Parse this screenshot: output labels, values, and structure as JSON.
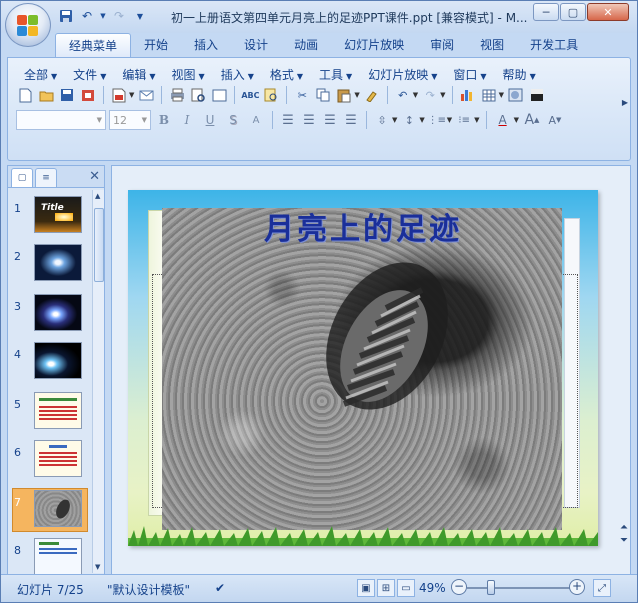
{
  "window": {
    "title": "初一上册语文第四单元月亮上的足迹PPT课件.ppt [兼容模式] - M...",
    "minimize": "─",
    "restore": "▢",
    "close": "✕"
  },
  "qat": {
    "save_icon": "save-icon",
    "undo_icon": "undo-icon",
    "redo_icon": "redo-icon",
    "customize_icon": "dropdown-icon"
  },
  "tabs": [
    "经典菜单",
    "开始",
    "插入",
    "设计",
    "动画",
    "幻灯片放映",
    "审阅",
    "视图",
    "开发工具"
  ],
  "menus": [
    "全部",
    "文件",
    "编辑",
    "视图",
    "插入",
    "格式",
    "工具",
    "幻灯片放映",
    "窗口",
    "帮助"
  ],
  "format": {
    "font_name": "",
    "font_size": "12",
    "bold": "B",
    "italic": "I",
    "underline": "U",
    "strike": "S",
    "shadow": "A",
    "font_color": "A",
    "grow": "A",
    "shrink": "A"
  },
  "thumbnails": [
    {
      "num": "1",
      "style": "dark-title",
      "label": "Title"
    },
    {
      "num": "2",
      "style": "space",
      "label": ""
    },
    {
      "num": "3",
      "style": "space",
      "label": ""
    },
    {
      "num": "4",
      "style": "space",
      "label": ""
    },
    {
      "num": "5",
      "style": "text",
      "label": ""
    },
    {
      "num": "6",
      "style": "text",
      "label": ""
    },
    {
      "num": "7",
      "style": "moon",
      "label": ""
    },
    {
      "num": "8",
      "style": "text",
      "label": ""
    }
  ],
  "slide": {
    "title": "月亮上的足迹"
  },
  "status": {
    "slide_info": "幻灯片 7/25",
    "template": "\"默认设计模板\"",
    "zoom": "49%"
  }
}
